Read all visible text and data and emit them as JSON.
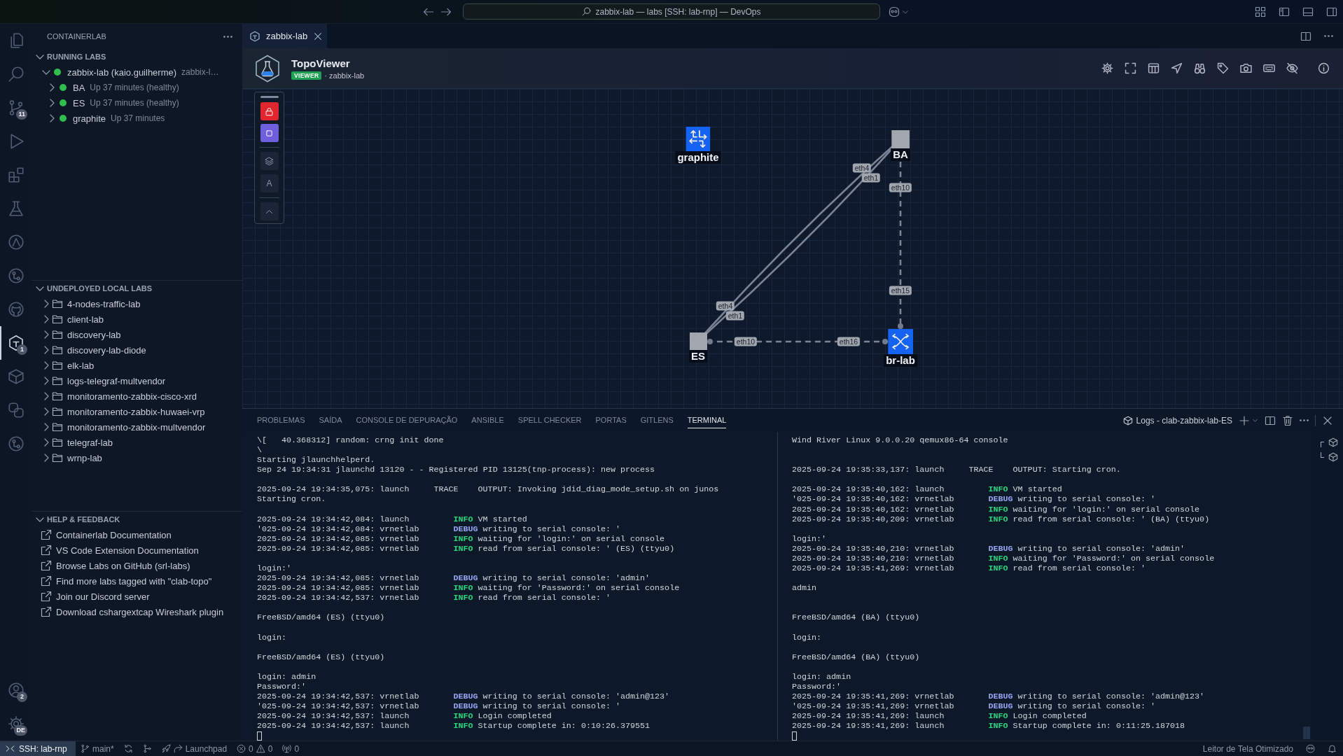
{
  "title_bar": {
    "search": "zabbix-lab — labs [SSH: lab-rnp] — DevOps"
  },
  "activity_bar": {
    "top": [
      {
        "selected": false
      },
      {
        "selected": false
      },
      {
        "selected": false,
        "badge": "11"
      },
      {
        "selected": false
      },
      {
        "selected": false
      },
      {
        "selected": false
      },
      {
        "selected": false
      },
      {
        "selected": false
      },
      {
        "selected": false
      },
      {
        "selected": true,
        "badge": "1"
      },
      {
        "selected": false
      },
      {
        "selected": false
      },
      {
        "selected": false
      }
    ],
    "bottom": [
      {
        "badge": "2"
      },
      {
        "badge": "DE"
      }
    ]
  },
  "sidebar": {
    "title": "CONTAINERLAB",
    "sections": [
      {
        "kind": "running",
        "title": "RUNNING LABS",
        "expanded": true,
        "items": [
          {
            "name": "zabbix-lab (kaio.guilherme)",
            "description": "zabbix-l…",
            "color": "#2ebf4f",
            "expanded": true,
            "children": [
              {
                "name": "BA",
                "description": "Up 37 minutes (healthy)",
                "color": "#2ebf4f",
                "expanded": false
              },
              {
                "name": "ES",
                "description": "Up 37 minutes (healthy)",
                "color": "#2ebf4f",
                "expanded": false
              },
              {
                "name": "graphite",
                "description": "Up 37 minutes",
                "color": "#2ebf4f",
                "expanded": false
              }
            ]
          }
        ]
      },
      {
        "kind": "folders",
        "title": "UNDEPLOYED LOCAL LABS",
        "expanded": true,
        "items": [
          {
            "name": "4-nodes-traffic-lab",
            "expanded": false
          },
          {
            "name": "client-lab",
            "expanded": false
          },
          {
            "name": "discovery-lab",
            "expanded": false
          },
          {
            "name": "discovery-lab-diode",
            "expanded": false
          },
          {
            "name": "elk-lab",
            "expanded": false
          },
          {
            "name": "logs-telegraf-multvendor",
            "expanded": false
          },
          {
            "name": "monitoramento-zabbix-cisco-xrd",
            "expanded": false
          },
          {
            "name": "monitoramento-zabbix-huwaei-vrp",
            "expanded": false
          },
          {
            "name": "monitoramento-zabbix-multvendor",
            "expanded": false
          },
          {
            "name": "telegraf-lab",
            "expanded": false
          },
          {
            "name": "wrnp-lab",
            "expanded": false
          }
        ]
      },
      {
        "kind": "links",
        "title": "HELP & FEEDBACK",
        "expanded": true,
        "items": [
          {
            "name": "Containerlab Documentation"
          },
          {
            "name": "VS Code Extension Documentation"
          },
          {
            "name": "Browse Labs on GitHub (srl-labs)"
          },
          {
            "name": "Find more labs tagged with \"clab-topo\""
          },
          {
            "name": "Join our Discord server"
          },
          {
            "name": "Download cshargextcap Wireshark plugin"
          }
        ]
      }
    ]
  },
  "editor": {
    "tabs": [
      {
        "label": "zabbix-lab",
        "selected": true
      }
    ],
    "viewer": {
      "title": "TopoViewer",
      "mode": "VIEWER",
      "lab": "· zabbix-lab"
    }
  },
  "canvas": {
    "locked": true,
    "text_toggle": "A",
    "nodes": [
      {
        "name": "graphite",
        "kind": "router"
      },
      {
        "name": "BA",
        "kind": "plain"
      },
      {
        "name": "ES",
        "kind": "plain"
      },
      {
        "name": "br-lab",
        "kind": "bridge"
      }
    ],
    "links": [
      {
        "labels": [
          "eth4",
          "eth4"
        ],
        "dashed": false
      },
      {
        "labels": [
          "eth1",
          "eth1"
        ],
        "dashed": false
      },
      {
        "labels": [
          "eth10",
          "eth15"
        ],
        "dashed": true
      },
      {
        "labels": [
          "eth10",
          "eth16"
        ],
        "dashed": true
      }
    ]
  },
  "panel": {
    "tabs": [
      {
        "label": "PROBLEMAS",
        "selected": false
      },
      {
        "label": "SAÍDA",
        "selected": false
      },
      {
        "label": "CONSOLE DE DEPURAÇÃO",
        "selected": false
      },
      {
        "label": "ANSIBLE",
        "selected": false
      },
      {
        "label": "SPELL CHECKER",
        "selected": false
      },
      {
        "label": "PORTAS",
        "selected": false
      },
      {
        "label": "GITLENS",
        "selected": false
      },
      {
        "label": "TERMINAL",
        "selected": true
      }
    ],
    "terminal_title": "Logs - clab-zabbix-lab-ES",
    "terminals": [
      {
        "lines": [
          {
            "kind": "plain",
            "text": "\\[   40.368312] random: crng init done"
          },
          {
            "kind": "plain",
            "text": "\\"
          },
          {
            "kind": "plain",
            "text": "Starting jlaunchhelperd."
          },
          {
            "kind": "plain",
            "text": "Sep 24 19:34:31 jlaunchd 13120 - - Registered PID 13125(tnp-process): new process"
          },
          {
            "kind": "blank"
          },
          {
            "kind": "trace",
            "time": "2025-09-24 19:34:35,075:",
            "source": "launch",
            "severity": "TRACE",
            "message": "OUTPUT: Invoking jdid_diag_mode_setup.sh on junos"
          },
          {
            "kind": "plain",
            "text": "Starting cron."
          },
          {
            "kind": "blank"
          },
          {
            "kind": "log",
            "time": "2025-09-24 19:34:42,084:",
            "source": "launch",
            "severity": "INFO",
            "color": "#29d67f",
            "message": "VM started"
          },
          {
            "kind": "log",
            "time": "'025-09-24 19:34:42,084:",
            "source": "vrnetlab",
            "severity": "DEBUG",
            "color": "#95a3f0",
            "message": "writing to serial console: '"
          },
          {
            "kind": "log",
            "time": "2025-09-24 19:34:42,085:",
            "source": "vrnetlab",
            "severity": "INFO",
            "color": "#29d67f",
            "message": "waiting for 'login:' on serial console"
          },
          {
            "kind": "log",
            "time": "2025-09-24 19:34:42,085:",
            "source": "vrnetlab",
            "severity": "INFO",
            "color": "#29d67f",
            "message": "read from serial console: ' (ES) (ttyu0)"
          },
          {
            "kind": "blank"
          },
          {
            "kind": "plain",
            "text": "login:'"
          },
          {
            "kind": "log",
            "time": "2025-09-24 19:34:42,085:",
            "source": "vrnetlab",
            "severity": "DEBUG",
            "color": "#95a3f0",
            "message": "writing to serial console: 'admin'"
          },
          {
            "kind": "log",
            "time": "2025-09-24 19:34:42,085:",
            "source": "vrnetlab",
            "severity": "INFO",
            "color": "#29d67f",
            "message": "waiting for 'Password:' on serial console"
          },
          {
            "kind": "log",
            "time": "2025-09-24 19:34:42,537:",
            "source": "vrnetlab",
            "severity": "INFO",
            "color": "#29d67f",
            "message": "read from serial console: '"
          },
          {
            "kind": "blank"
          },
          {
            "kind": "plain",
            "text": "FreeBSD/amd64 (ES) (ttyu0)"
          },
          {
            "kind": "blank"
          },
          {
            "kind": "plain",
            "text": "login:"
          },
          {
            "kind": "blank"
          },
          {
            "kind": "plain",
            "text": "FreeBSD/amd64 (ES) (ttyu0)"
          },
          {
            "kind": "blank"
          },
          {
            "kind": "plain",
            "text": "login: admin"
          },
          {
            "kind": "plain",
            "text": "Password:'"
          },
          {
            "kind": "log",
            "time": "2025-09-24 19:34:42,537:",
            "source": "vrnetlab",
            "severity": "DEBUG",
            "color": "#95a3f0",
            "message": "writing to serial console: 'admin@123'"
          },
          {
            "kind": "log",
            "time": "'025-09-24 19:34:42,537:",
            "source": "vrnetlab",
            "severity": "DEBUG",
            "color": "#95a3f0",
            "message": "writing to serial console: '"
          },
          {
            "kind": "log",
            "time": "2025-09-24 19:34:42,537:",
            "source": "launch",
            "severity": "INFO",
            "color": "#29d67f",
            "message": "Login completed"
          },
          {
            "kind": "log",
            "time": "2025-09-24 19:34:42,537:",
            "source": "launch",
            "severity": "INFO",
            "color": "#29d67f",
            "message": "Startup complete in: 0:10:26.379551"
          }
        ]
      },
      {
        "lines": [
          {
            "kind": "plain",
            "text": "Wind River Linux 9.0.0.20 qemux86-64 console"
          },
          {
            "kind": "blank"
          },
          {
            "kind": "blank"
          },
          {
            "kind": "trace",
            "time": "2025-09-24 19:35:33,137:",
            "source": "launch",
            "severity": "TRACE",
            "message": "OUTPUT: Starting cron."
          },
          {
            "kind": "blank"
          },
          {
            "kind": "log",
            "time": "2025-09-24 19:35:40,162:",
            "source": "launch",
            "severity": "INFO",
            "color": "#29d67f",
            "message": "VM started"
          },
          {
            "kind": "log",
            "time": "'025-09-24 19:35:40,162:",
            "source": "vrnetlab",
            "severity": "DEBUG",
            "color": "#95a3f0",
            "message": "writing to serial console: '"
          },
          {
            "kind": "log",
            "time": "2025-09-24 19:35:40,162:",
            "source": "vrnetlab",
            "severity": "INFO",
            "color": "#29d67f",
            "message": "waiting for 'login:' on serial console"
          },
          {
            "kind": "log",
            "time": "2025-09-24 19:35:40,209:",
            "source": "vrnetlab",
            "severity": "INFO",
            "color": "#29d67f",
            "message": "read from serial console: ' (BA) (ttyu0)"
          },
          {
            "kind": "blank"
          },
          {
            "kind": "plain",
            "text": "login:'"
          },
          {
            "kind": "log",
            "time": "2025-09-24 19:35:40,210:",
            "source": "vrnetlab",
            "severity": "DEBUG",
            "color": "#95a3f0",
            "message": "writing to serial console: 'admin'"
          },
          {
            "kind": "log",
            "time": "2025-09-24 19:35:40,210:",
            "source": "vrnetlab",
            "severity": "INFO",
            "color": "#29d67f",
            "message": "waiting for 'Password:' on serial console"
          },
          {
            "kind": "log",
            "time": "2025-09-24 19:35:41,269:",
            "source": "vrnetlab",
            "severity": "INFO",
            "color": "#29d67f",
            "message": "read from serial console: '"
          },
          {
            "kind": "blank"
          },
          {
            "kind": "plain",
            "text": "admin"
          },
          {
            "kind": "blank"
          },
          {
            "kind": "blank"
          },
          {
            "kind": "plain",
            "text": "FreeBSD/amd64 (BA) (ttyu0)"
          },
          {
            "kind": "blank"
          },
          {
            "kind": "plain",
            "text": "login:"
          },
          {
            "kind": "blank"
          },
          {
            "kind": "plain",
            "text": "FreeBSD/amd64 (BA) (ttyu0)"
          },
          {
            "kind": "blank"
          },
          {
            "kind": "plain",
            "text": "login: admin"
          },
          {
            "kind": "plain",
            "text": "Password:'"
          },
          {
            "kind": "log",
            "time": "2025-09-24 19:35:41,269:",
            "source": "vrnetlab",
            "severity": "DEBUG",
            "color": "#95a3f0",
            "message": "writing to serial console: 'admin@123'"
          },
          {
            "kind": "log",
            "time": "'025-09-24 19:35:41,269:",
            "source": "vrnetlab",
            "severity": "DEBUG",
            "color": "#95a3f0",
            "message": "writing to serial console: '"
          },
          {
            "kind": "log",
            "time": "2025-09-24 19:35:41,269:",
            "source": "launch",
            "severity": "INFO",
            "color": "#29d67f",
            "message": "Login completed"
          },
          {
            "kind": "log",
            "time": "2025-09-24 19:35:41,269:",
            "source": "launch",
            "severity": "INFO",
            "color": "#29d67f",
            "message": "Startup complete in: 0:11:25.187018"
          }
        ]
      }
    ]
  },
  "status_bar": {
    "remote": "SSH: lab-rnp",
    "branch": "main*",
    "launchpad": "Launchpad",
    "errors": "0",
    "warnings": "0",
    "ports": "0",
    "screen_reader": "Leitor de Tela Otimizado"
  }
}
